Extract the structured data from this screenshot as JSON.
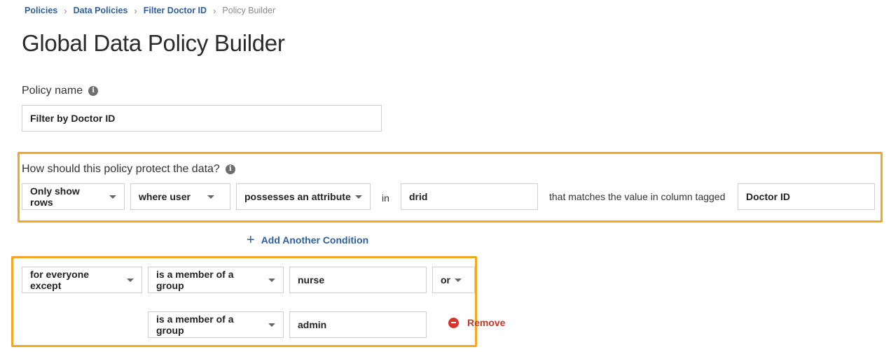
{
  "breadcrumb": {
    "items": [
      "Policies",
      "Data Policies",
      "Filter Doctor ID"
    ],
    "current": "Policy Builder",
    "separator": "›"
  },
  "page": {
    "title": "Global Data Policy Builder"
  },
  "policy_name": {
    "label": "Policy name",
    "value": "Filter by Doctor ID"
  },
  "protection": {
    "label": "How should this policy protect the data?",
    "action": "Only show rows",
    "condition": "where user",
    "predicate": "possesses an attribute",
    "in_text": "in",
    "attribute": "drid",
    "match_text": "that matches the value in column tagged",
    "column_tag": "Doctor ID"
  },
  "add_condition": {
    "label": "Add Another Condition",
    "icon": "plus-icon"
  },
  "exceptions": {
    "scope": "for everyone except",
    "rows": [
      {
        "relation": "is a member of a group",
        "value": "nurse"
      },
      {
        "relation": "is a member of a group",
        "value": "admin"
      }
    ],
    "conjunction": "or",
    "remove_label": "Remove"
  },
  "colors": {
    "highlight": "#f5a623",
    "link": "#2e5f9c",
    "remove": "#c0392b"
  }
}
